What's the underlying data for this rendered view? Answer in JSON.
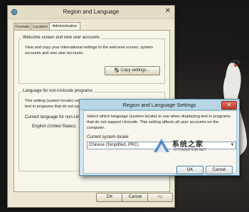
{
  "main_window": {
    "title": "Region and Language",
    "tabs": [
      {
        "label": "Formats"
      },
      {
        "label": "Location"
      },
      {
        "label": "Administrative"
      }
    ],
    "welcome_group": {
      "label": "Welcome screen and new user accounts",
      "description_line1": "View and copy your international settings to the welcome screen, system",
      "description_line2": "accounts and new user accounts.",
      "copy_button": "Copy settings..."
    },
    "unicode_group": {
      "label": "Language for non-Unicode programs",
      "description_line1": "This setting (system locale) controls the language used when displaying",
      "description_line2": "text in programs that do not support Unicode.",
      "current_label": "Current language for non-Uni",
      "current_value": "English (United States)"
    },
    "buttons": {
      "ok": "OK",
      "cancel": "Cancel",
      "apply": "Ap"
    }
  },
  "dialog": {
    "title": "Region and Language Settings",
    "description_line1": "Select which language (system locale) to use when displaying text in programs",
    "description_line2": "that do not support Unicode. This setting affects all user accounts on the",
    "description_line3": "computer.",
    "locale_label": "Current system locale:",
    "locale_value": "Chinese (Simplified, PRC)",
    "buttons": {
      "ok": "OK",
      "cancel": "Cancel"
    }
  },
  "watermark": {
    "text": "系统之家",
    "subtext": "XITONGZHIJIA.NET"
  },
  "colors": {
    "main_window_bg": "#ece6d2",
    "dialog_frame": "#cfe3ee",
    "desktop_bg": "#1a1818"
  }
}
